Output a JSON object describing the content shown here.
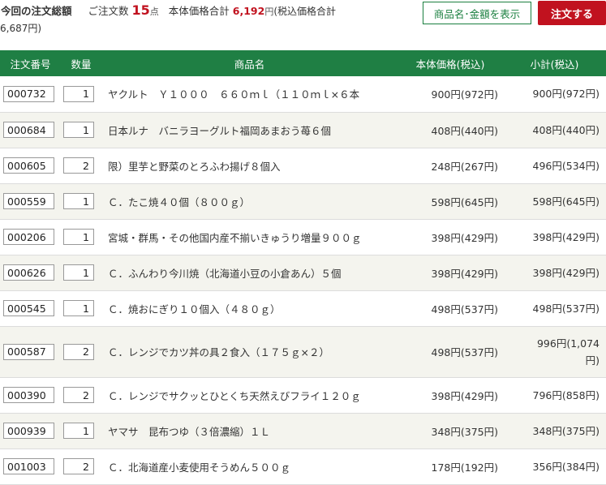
{
  "summary": {
    "title": "今回の注文総額",
    "qty_label": "ご注文数",
    "qty_value": "15",
    "qty_unit": "点",
    "base_label": "本体価格合計",
    "base_value": "6,192",
    "base_unit": "円",
    "tax_label_prefix": "(税込価格合計",
    "tax_value": "6,687",
    "tax_suffix": "円)"
  },
  "buttons": {
    "show_label": "商品名･金額を表示",
    "order_label": "注文する"
  },
  "table": {
    "headers": {
      "id": "注文番号",
      "qty": "数量",
      "name": "商品名",
      "price": "本体価格(税込)",
      "subtotal": "小計(税込)"
    },
    "rows": [
      {
        "id": "000732",
        "qty": "1",
        "name": "ヤクルト　Ｙ１０００　６６０ｍｌ（１１０ｍｌ×６本",
        "price": "900円(972円)",
        "subtotal": "900円(972円)"
      },
      {
        "id": "000684",
        "qty": "1",
        "name": "日本ルナ　バニラヨーグルト福岡あまおう苺６個",
        "price": "408円(440円)",
        "subtotal": "408円(440円)"
      },
      {
        "id": "000605",
        "qty": "2",
        "name": "限）里芋と野菜のとろふわ揚げ８個入",
        "price": "248円(267円)",
        "subtotal": "496円(534円)"
      },
      {
        "id": "000559",
        "qty": "1",
        "name": "Ｃ．たこ焼４０個（８００ｇ）",
        "price": "598円(645円)",
        "subtotal": "598円(645円)"
      },
      {
        "id": "000206",
        "qty": "1",
        "name": "宮城・群馬・その他国内産不揃いきゅうり増量９００ｇ",
        "price": "398円(429円)",
        "subtotal": "398円(429円)"
      },
      {
        "id": "000626",
        "qty": "1",
        "name": "Ｃ．ふんわり今川焼（北海道小豆の小倉あん）５個",
        "price": "398円(429円)",
        "subtotal": "398円(429円)"
      },
      {
        "id": "000545",
        "qty": "1",
        "name": "Ｃ．焼おにぎり１０個入（４８０ｇ）",
        "price": "498円(537円)",
        "subtotal": "498円(537円)"
      },
      {
        "id": "000587",
        "qty": "2",
        "name": "Ｃ．レンジでカツ丼の具２食入（１７５ｇ×２）",
        "price": "498円(537円)",
        "subtotal_line1": "996円(1,074",
        "subtotal_line2": "円)"
      },
      {
        "id": "000390",
        "qty": "2",
        "name": "Ｃ．レンジでサクッとひとくち天然えびフライ１２０ｇ",
        "price": "398円(429円)",
        "subtotal": "796円(858円)"
      },
      {
        "id": "000939",
        "qty": "1",
        "name": "ヤマサ　昆布つゆ（３倍濃縮）１Ｌ",
        "price": "348円(375円)",
        "subtotal": "348円(375円)"
      },
      {
        "id": "001003",
        "qty": "2",
        "name": "Ｃ．北海道産小麦使用そうめん５００ｇ",
        "price": "178円(192円)",
        "subtotal": "356円(384円)"
      }
    ]
  }
}
